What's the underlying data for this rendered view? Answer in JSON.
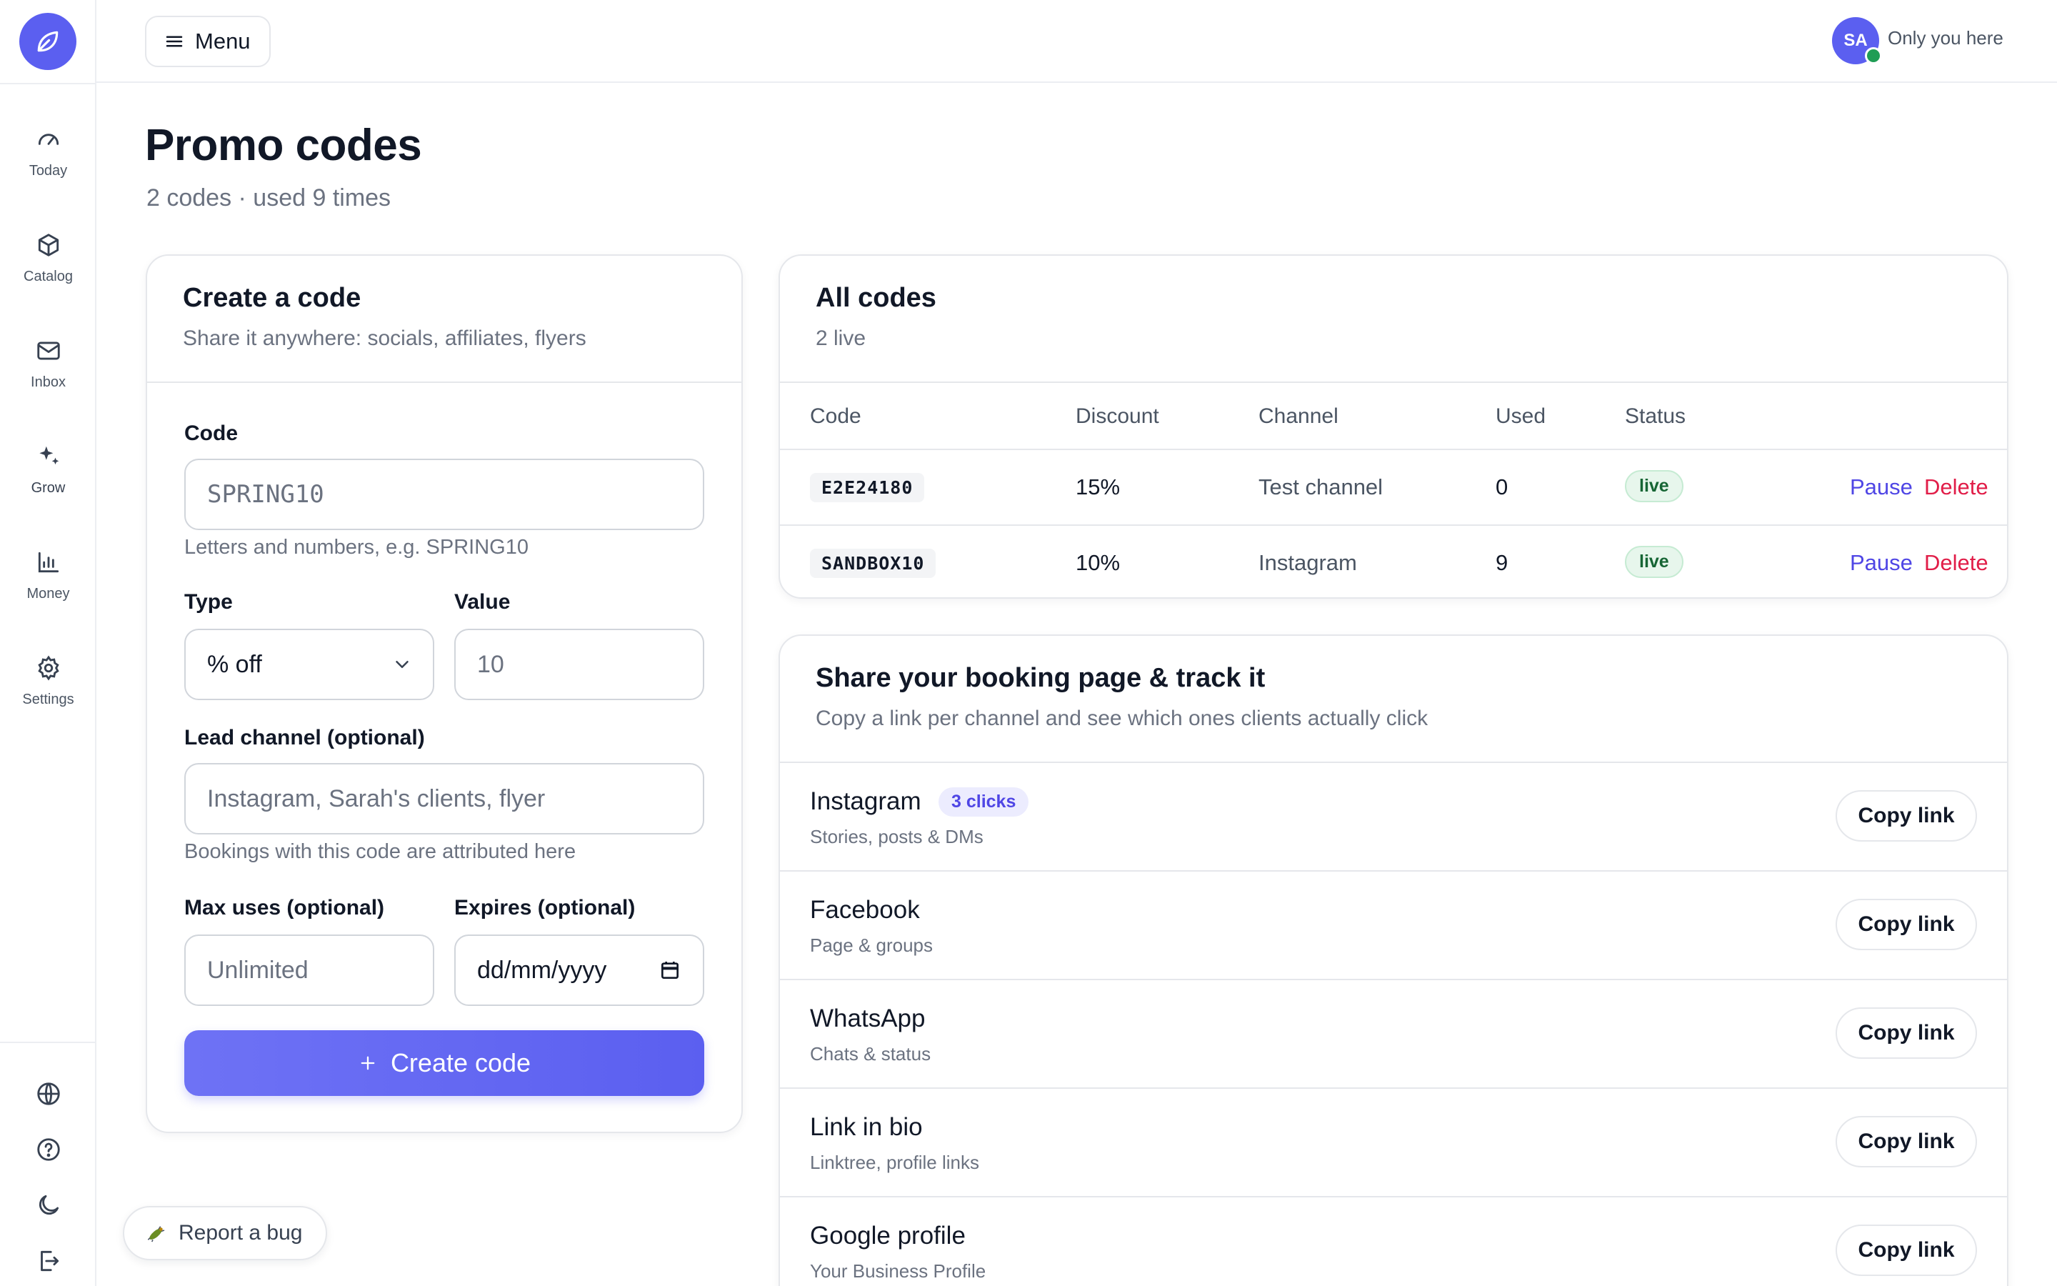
{
  "sidebar": {
    "logo_icon": "leaf-icon",
    "brand_color": "#5b5ff0",
    "items": [
      {
        "label": "Today",
        "icon": "speedometer-icon"
      },
      {
        "label": "Catalog",
        "icon": "box-icon"
      },
      {
        "label": "Inbox",
        "icon": "mail-icon"
      },
      {
        "label": "Grow",
        "icon": "sparkles-icon"
      },
      {
        "label": "Money",
        "icon": "bar-chart-icon"
      },
      {
        "label": "Settings",
        "icon": "gear-icon"
      }
    ],
    "bottom_icons": [
      "globe-icon",
      "help-icon",
      "moon-icon",
      "logout-icon"
    ]
  },
  "topbar": {
    "menu_label": "Menu",
    "avatar_initials": "SA",
    "user_label": "Only you here",
    "online_color": "#1f9d55"
  },
  "page": {
    "title": "Promo codes",
    "subtitle": "2 codes · used 9 times"
  },
  "create_form": {
    "title": "Create a code",
    "subtitle": "Share it anywhere: socials, affiliates, flyers",
    "code_label": "Code",
    "code_placeholder": "SPRING10",
    "code_hint": "Letters and numbers, e.g. SPRING10",
    "type_label": "Type",
    "type_value": "% off",
    "value_label": "Value",
    "value_placeholder": "10",
    "channel_label": "Lead channel (optional)",
    "channel_placeholder": "Instagram, Sarah's clients, flyer",
    "channel_hint": "Bookings with this code are attributed here",
    "max_uses_label": "Max uses (optional)",
    "max_uses_placeholder": "Unlimited",
    "expires_label": "Expires (optional)",
    "expires_placeholder": "dd/mm/yyyy",
    "submit_label": "Create code"
  },
  "all_codes": {
    "title": "All codes",
    "subtitle": "2 live",
    "columns": [
      "Code",
      "Discount",
      "Channel",
      "Used",
      "Status"
    ],
    "rows": [
      {
        "code": "E2E24180",
        "discount": "15%",
        "channel": "Test channel",
        "used": "0",
        "status": "live",
        "pause": "Pause",
        "delete": "Delete"
      },
      {
        "code": "SANDBOX10",
        "discount": "10%",
        "channel": "Instagram",
        "used": "9",
        "status": "live",
        "pause": "Pause",
        "delete": "Delete"
      }
    ],
    "pause_color": "#4f46e5",
    "delete_color": "#e11d48"
  },
  "share": {
    "title": "Share your booking page & track it",
    "subtitle": "Copy a link per channel and see which ones clients actually click",
    "copy_label": "Copy link",
    "channels": [
      {
        "name": "Instagram",
        "desc": "Stories, posts & DMs",
        "clicks": "3 clicks"
      },
      {
        "name": "Facebook",
        "desc": "Page & groups"
      },
      {
        "name": "WhatsApp",
        "desc": "Chats & status"
      },
      {
        "name": "Link in bio",
        "desc": "Linktree, profile links"
      },
      {
        "name": "Google profile",
        "desc": "Your Business Profile"
      }
    ]
  },
  "bug_report": {
    "label": "Report a bug",
    "icon": "bug-icon"
  }
}
